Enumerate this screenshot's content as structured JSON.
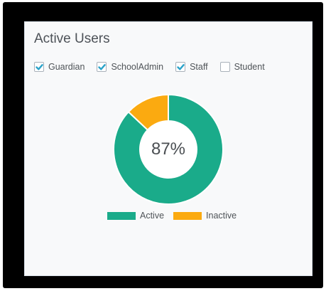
{
  "card": {
    "title": "Active Users"
  },
  "filters": [
    {
      "label": "Guardian",
      "checked": true
    },
    {
      "label": "SchoolAdmin",
      "checked": true
    },
    {
      "label": "Staff",
      "checked": true
    },
    {
      "label": "Student",
      "checked": false
    }
  ],
  "colors": {
    "active": "#1aab8a",
    "inactive": "#fbaa10",
    "check": "#2aa3c9"
  },
  "chart_data": {
    "type": "pie",
    "center_label": "87%",
    "categories": [
      "Active",
      "Inactive"
    ],
    "values": [
      87,
      13
    ],
    "legend_position": "bottom"
  },
  "legend": [
    {
      "label": "Active"
    },
    {
      "label": "Inactive"
    }
  ]
}
